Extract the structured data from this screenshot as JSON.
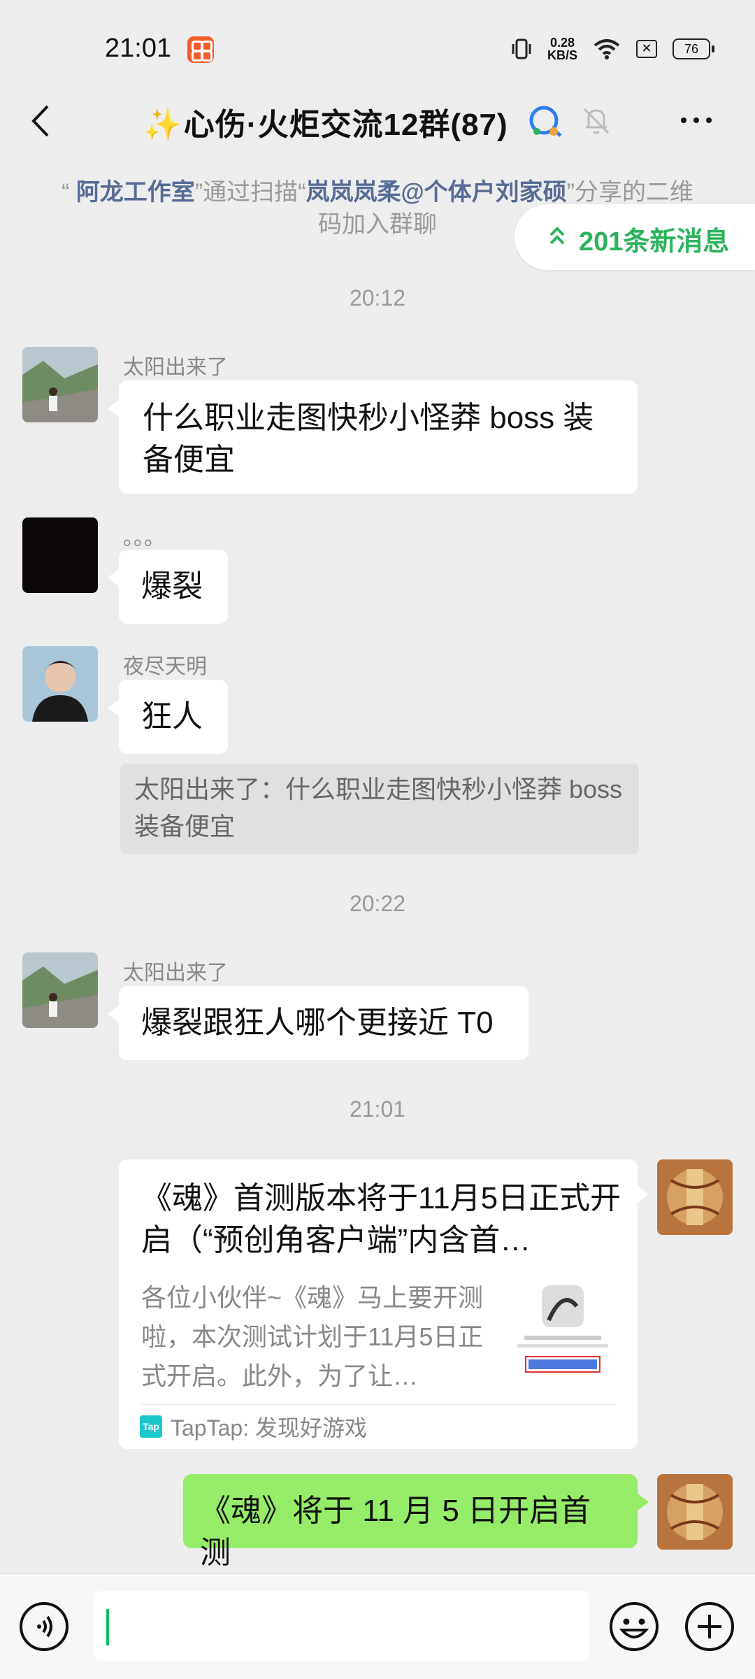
{
  "status_bar": {
    "time": "21:01",
    "app_icon": "orange-app-icon",
    "speed_value": "0.28",
    "speed_unit": "KB/S",
    "battery": "76",
    "icons": [
      "vibrate-icon",
      "wifi-icon",
      "sim-off-icon",
      "battery-icon"
    ]
  },
  "header": {
    "title": "心伤·火炬交流12群(87)",
    "title_prefix": "✨",
    "icons": [
      "back-icon",
      "group-chat-icon",
      "mute-bell-icon",
      "more-icon"
    ]
  },
  "system_notice": {
    "quote_open": "“",
    "user": "阿龙工作室",
    "quote_close": "”",
    "text1": "通过扫描",
    "sharer_open": "“",
    "sharer": "岚岚岚柔@个体户刘家硕",
    "sharer_close": "”",
    "text2": "分享的二维码加入群聊"
  },
  "new_messages": {
    "label": "201条新消息"
  },
  "timestamps": {
    "t1": "20:12",
    "t2": "20:22",
    "t3": "21:01"
  },
  "messages": [
    {
      "sender": "太阳出来了",
      "text": "什么职业走图快秒小怪莽 boss  装备便宜"
    },
    {
      "sender": "。。。",
      "text": "爆裂"
    },
    {
      "sender": "夜尽天明",
      "text": "狂人",
      "quote": "太阳出来了：什么职业走图快秒小怪莽 boss  装备便宜"
    },
    {
      "sender": "太阳出来了",
      "text": "爆裂跟狂人哪个更接近 T0"
    }
  ],
  "share_card": {
    "title": "《魂》首测版本将于11月5日正式开启（“预创角客户端”内含首…",
    "description": "各位小伙伴~《魂》马上要开测啦，本次测试计划于11月5日正式开启。此外，为了让…",
    "source_logo": "Tap",
    "source": "TapTap: 发现好游戏"
  },
  "my_message": {
    "text": "《魂》将于 11 月 5 日开启首测"
  },
  "input_bar": {
    "icons": [
      "voice-icon",
      "emoji-icon",
      "plus-icon"
    ]
  },
  "colors": {
    "background": "#EDEDED",
    "accent_green": "#2BB35B",
    "my_bubble": "#95EC69",
    "link_blue": "#576B95",
    "caret": "#07C160"
  }
}
